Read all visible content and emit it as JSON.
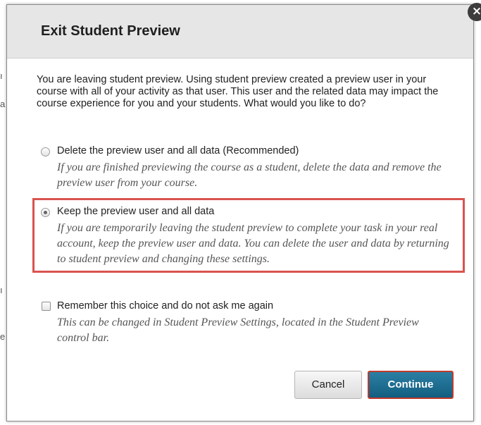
{
  "dialog": {
    "title": "Exit Student Preview",
    "close_glyph": "×",
    "intro": "You are leaving student preview. Using student preview created a preview user in your course with all of your activity as that user. This user and the related data may impact the course experience for you and your students. What would you like to do?",
    "options": [
      {
        "label": "Delete the preview user and all data (Recommended)",
        "description": "If you are finished previewing the course as a student, delete the data and remove the preview user from your course.",
        "selected": false
      },
      {
        "label": "Keep the preview user and all data",
        "description": "If you are temporarily leaving the student preview to complete your task in your real account, keep the preview user and data. You can delete the user and data by returning to student preview and changing these settings.",
        "selected": true
      }
    ],
    "remember": {
      "label": "Remember this choice and do not ask me again",
      "description": "This can be changed in Student Preview Settings, located in the Student Preview control bar.",
      "checked": false
    },
    "buttons": {
      "cancel": "Cancel",
      "continue": "Continue"
    }
  },
  "colors": {
    "header_bg": "#e6e6e6",
    "primary_button": "#1a6d92",
    "highlight_border": "#d9534f"
  }
}
